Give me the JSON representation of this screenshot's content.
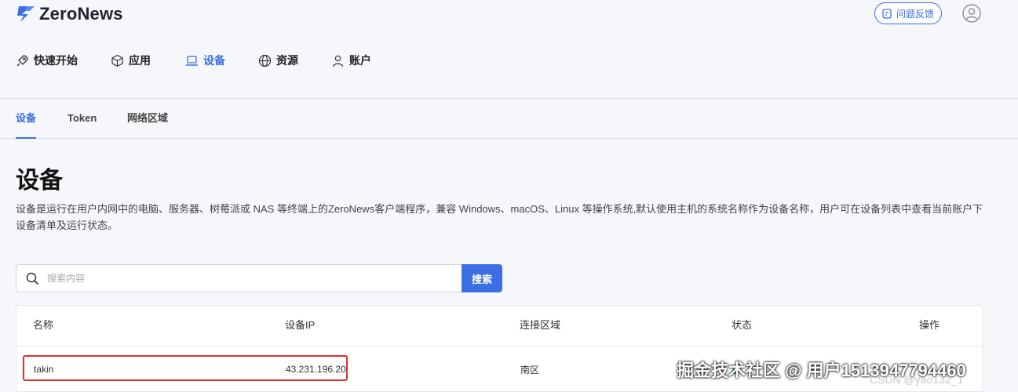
{
  "app": {
    "logo_text": "ZeroNews",
    "brand_color": "#3b6fe3"
  },
  "header": {
    "feedback_label": "问题反馈"
  },
  "nav": {
    "items": [
      {
        "label": "快速开始",
        "icon": "rocket-icon"
      },
      {
        "label": "应用",
        "icon": "cube-icon"
      },
      {
        "label": "设备",
        "icon": "laptop-icon"
      },
      {
        "label": "资源",
        "icon": "globe-icon"
      },
      {
        "label": "账户",
        "icon": "user-icon"
      }
    ],
    "active": "设备"
  },
  "subtabs": [
    "设备",
    "Token",
    "网络区域"
  ],
  "page": {
    "title": "设备",
    "description": "设备是运行在用户内网中的电脑、服务器、树莓派或 NAS 等终端上的ZeroNews客户端程序，兼容 Windows、macOS、Linux 等操作系统,默认使用主机的系统名称作为设备名称，用户可在设备列表中查看当前账户下设备清单及运行状态。"
  },
  "search": {
    "placeholder": "搜索内容",
    "button_label": "搜索"
  },
  "table": {
    "columns": [
      "名称",
      "设备IP",
      "连接区域",
      "状态",
      "操作"
    ],
    "rows": [
      {
        "name": "takin",
        "ip": "43.231.196.20",
        "region": "南区",
        "status": "",
        "action": ""
      }
    ]
  },
  "watermark": {
    "text": "掘金技术社区 @ 用户1513947794460",
    "sub": "CSDN @yao132_1"
  }
}
